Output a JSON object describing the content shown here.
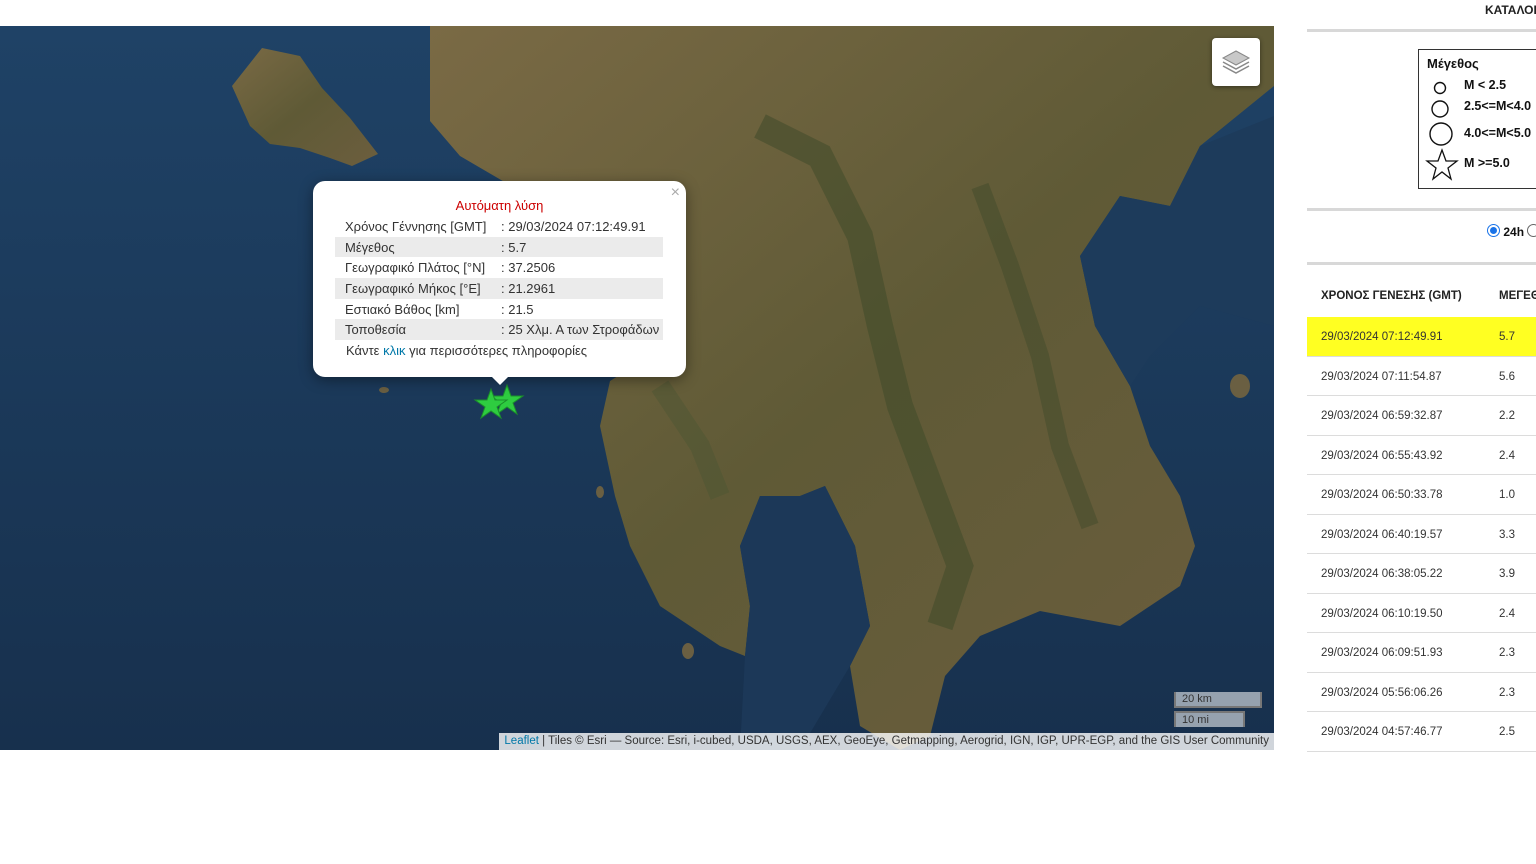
{
  "map": {
    "attribution_leaflet": "Leaflet",
    "attribution_rest": " | Tiles © Esri — Source: Esri, i-cubed, USDA, USGS, AEX, GeoEye, Getmapping, Aerogrid, IGN, IGP, UPR-EGP, and the GIS User Community",
    "scale_km": "20 km",
    "scale_mi": "10 mi",
    "layers_icon": "layers-icon",
    "marker_color": "#2ecc40"
  },
  "popup": {
    "close": "×",
    "title": "Αυτόματη λύση",
    "rows": [
      {
        "label": "Χρόνος Γέννησης [GMT]",
        "value": ": 29/03/2024 07:12:49.91"
      },
      {
        "label": "Μέγεθος",
        "value": ": 5.7"
      },
      {
        "label": "Γεωγραφικό Πλάτος [°N]",
        "value": ": 37.2506"
      },
      {
        "label": "Γεωγραφικό Μήκος [°E]",
        "value": ": 21.2961"
      },
      {
        "label": "Εστιακό Βάθος [km]",
        "value": ": 21.5"
      },
      {
        "label": "Τοποθεσία",
        "value": ": 25 Χλμ. Α των Στροφάδων"
      }
    ],
    "more_prefix": "Κάντε ",
    "more_link": "κλικ",
    "more_suffix": " για περισσότερες πληροφορίες"
  },
  "side": {
    "catalog_link": "ΚΑΤΑΛΟΓΟΣ",
    "legend": {
      "title": "Μέγεθος",
      "items": [
        "M < 2.5",
        "2.5<=M<4.0",
        "4.0<=M<5.0",
        "M >=5.0"
      ]
    },
    "period_selected": "24h",
    "table": {
      "col_time": "ΧΡΟΝΟΣ ΓΕΝΕΣΗΣ (GMT)",
      "col_mag": "ΜΕΓΕΘΟΣ",
      "selected_color": "#ffff22",
      "rows": [
        {
          "time": "29/03/2024 07:12:49.91",
          "mag": "5.7"
        },
        {
          "time": "29/03/2024 07:11:54.87",
          "mag": "5.6"
        },
        {
          "time": "29/03/2024 06:59:32.87",
          "mag": "2.2"
        },
        {
          "time": "29/03/2024 06:55:43.92",
          "mag": "2.4"
        },
        {
          "time": "29/03/2024 06:50:33.78",
          "mag": "1.0"
        },
        {
          "time": "29/03/2024 06:40:19.57",
          "mag": "3.3"
        },
        {
          "time": "29/03/2024 06:38:05.22",
          "mag": "3.9"
        },
        {
          "time": "29/03/2024 06:10:19.50",
          "mag": "2.4"
        },
        {
          "time": "29/03/2024 06:09:51.93",
          "mag": "2.3"
        },
        {
          "time": "29/03/2024 05:56:06.26",
          "mag": "2.3"
        },
        {
          "time": "29/03/2024 04:57:46.77",
          "mag": "2.5"
        }
      ]
    }
  }
}
